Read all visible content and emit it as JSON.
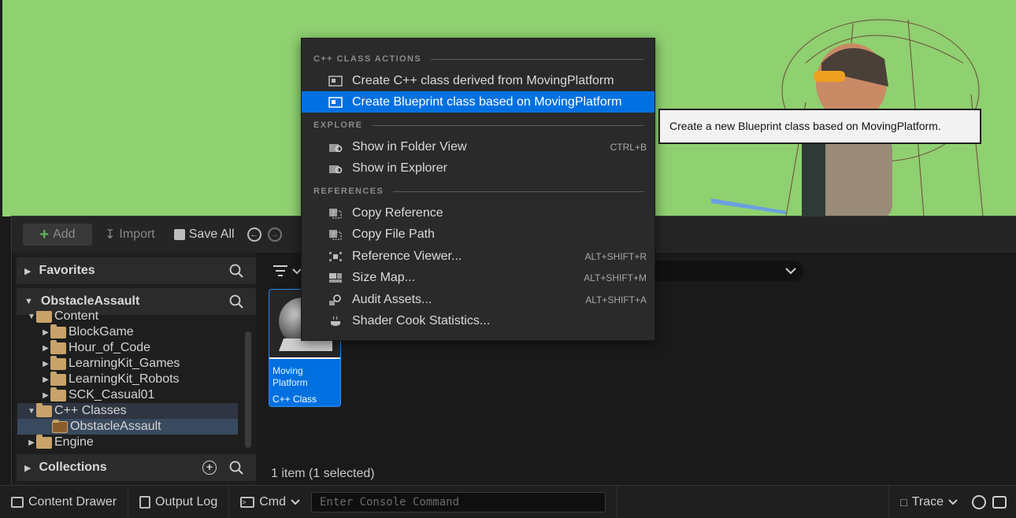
{
  "toolbar": {
    "add_label": "Add",
    "import_label": "Import",
    "save_all_label": "Save All"
  },
  "left": {
    "favorites_label": "Favorites",
    "project_label": "ObstacleAssault",
    "collections_label": "Collections",
    "tree": [
      {
        "label": "Content"
      },
      {
        "label": "BlockGame"
      },
      {
        "label": "Hour_of_Code"
      },
      {
        "label": "LearningKit_Games"
      },
      {
        "label": "LearningKit_Robots"
      },
      {
        "label": "SCK_Casual01"
      },
      {
        "label": "C++ Classes"
      },
      {
        "label": "ObstacleAssault"
      },
      {
        "label": "Engine"
      }
    ]
  },
  "asset": {
    "name": "Moving Platform",
    "type": "C++ Class"
  },
  "status": "1 item (1 selected)",
  "bottom": {
    "content_drawer": "Content Drawer",
    "output_log": "Output Log",
    "cmd": "Cmd",
    "console_placeholder": "Enter Console Command",
    "trace": "Trace"
  },
  "menu": {
    "sections": {
      "cpp": "C++ CLASS ACTIONS",
      "explore": "EXPLORE",
      "references": "REFERENCES"
    },
    "items": {
      "create_cpp": {
        "label": "Create C++ class derived from MovingPlatform",
        "shortcut": ""
      },
      "create_bp": {
        "label": "Create Blueprint class based on MovingPlatform",
        "shortcut": ""
      },
      "folder_view": {
        "label": "Show in Folder View",
        "shortcut": "CTRL+B"
      },
      "explorer": {
        "label": "Show in Explorer",
        "shortcut": ""
      },
      "copy_ref": {
        "label": "Copy Reference",
        "shortcut": ""
      },
      "copy_path": {
        "label": "Copy File Path",
        "shortcut": ""
      },
      "ref_viewer": {
        "label": "Reference Viewer...",
        "shortcut": "ALT+SHIFT+R"
      },
      "size_map": {
        "label": "Size Map...",
        "shortcut": "ALT+SHIFT+M"
      },
      "audit": {
        "label": "Audit Assets...",
        "shortcut": "ALT+SHIFT+A"
      },
      "shader": {
        "label": "Shader Cook Statistics...",
        "shortcut": ""
      }
    }
  },
  "tooltip": "Create a new Blueprint class based on MovingPlatform."
}
